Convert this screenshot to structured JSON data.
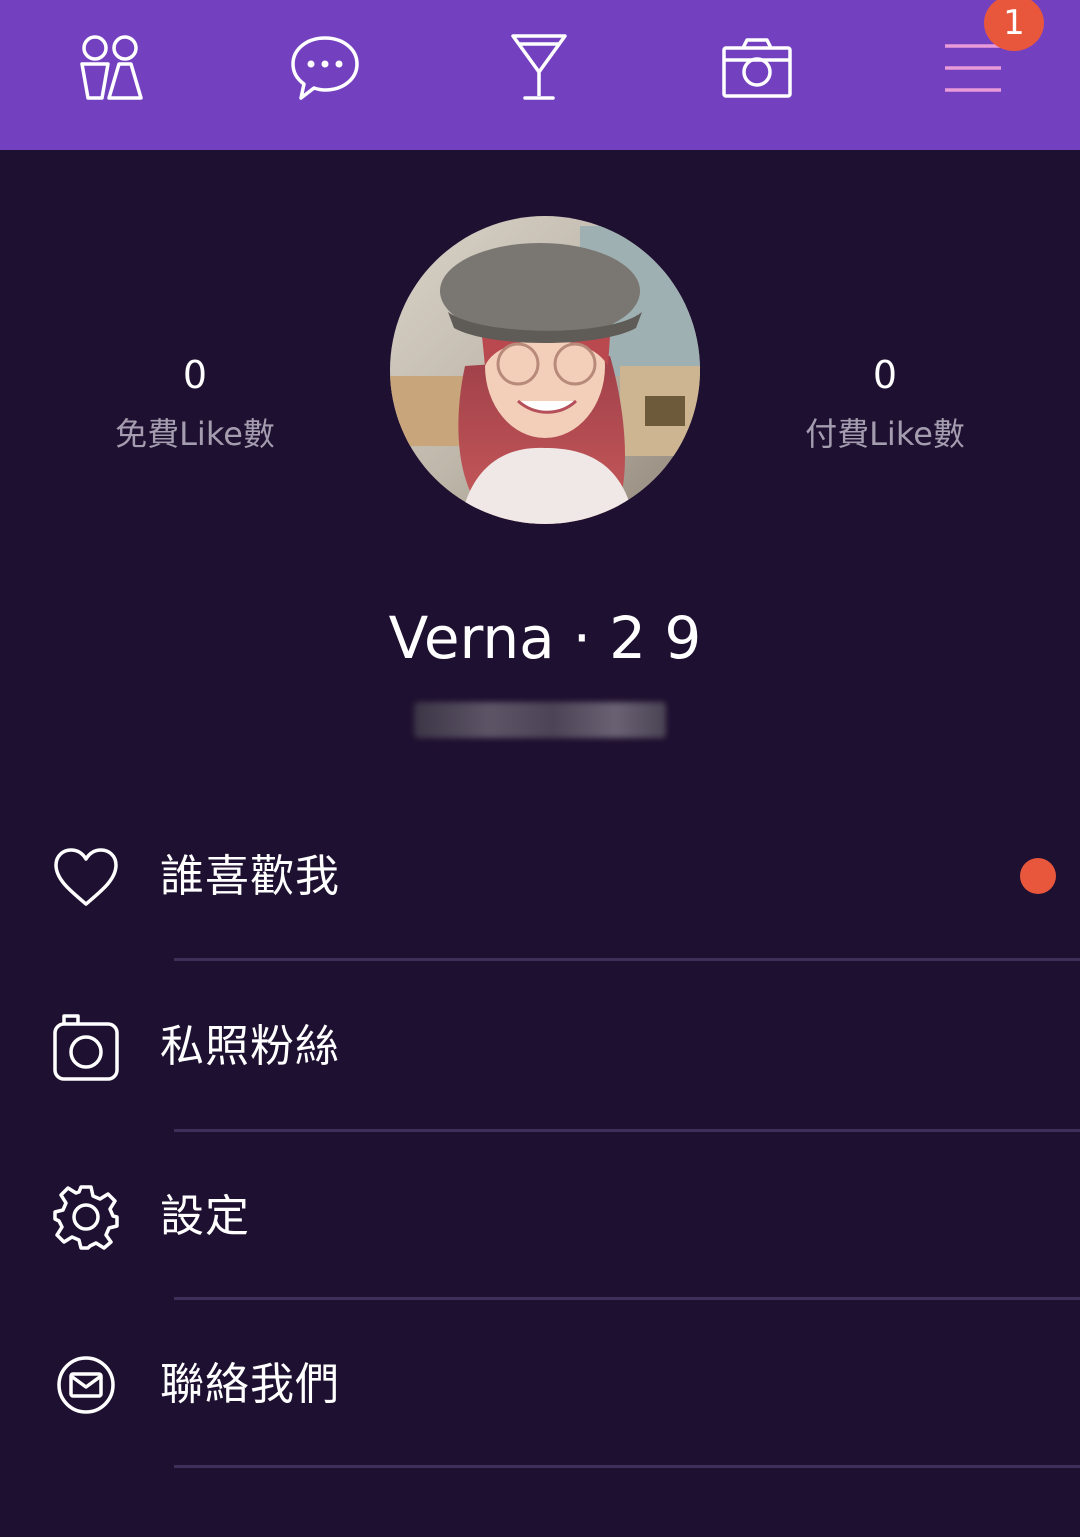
{
  "topnav": {
    "items": [
      {
        "icon": "people-icon"
      },
      {
        "icon": "chat-bubble-icon"
      },
      {
        "icon": "cocktail-glass-icon"
      },
      {
        "icon": "camera-icon"
      },
      {
        "icon": "hamburger-menu-icon"
      }
    ],
    "menu_badge": "1",
    "bar_color": "#7341c0",
    "badge_color": "#e8573c"
  },
  "profile": {
    "free_likes": {
      "value": "0",
      "label": "免費Like數"
    },
    "paid_likes": {
      "value": "0",
      "label": "付費Like數"
    },
    "name": "Verna",
    "separator": "·",
    "age": "2 9",
    "background_color": "#1e1030"
  },
  "menu": {
    "items": [
      {
        "icon": "heart-icon",
        "label": "誰喜歡我",
        "has_notification_dot": true
      },
      {
        "icon": "camera-icon",
        "label": "私照粉絲"
      },
      {
        "icon": "gear-icon",
        "label": "設定"
      },
      {
        "icon": "mail-icon",
        "label": "聯絡我們"
      }
    ]
  }
}
